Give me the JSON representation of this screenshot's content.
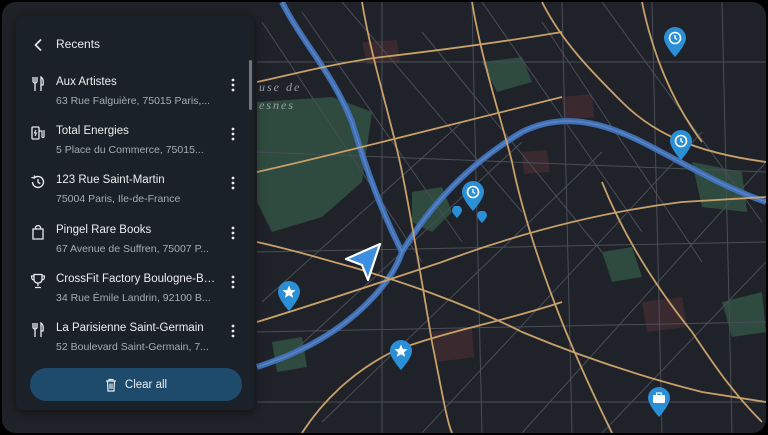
{
  "panel": {
    "title": "Recents",
    "items": [
      {
        "icon": "restaurant-icon",
        "title": "Aux Artistes",
        "subtitle": "63 Rue Falguière, 75015 Paris,..."
      },
      {
        "icon": "ev-station-icon",
        "title": "Total Energies",
        "subtitle": "5 Place du Commerce, 75015..."
      },
      {
        "icon": "history-icon",
        "title": "123 Rue Saint-Martin",
        "subtitle": "75004 Paris, Ile-de-France"
      },
      {
        "icon": "shopping-bag-icon",
        "title": "Pingel Rare Books",
        "subtitle": "67 Avenue de Suffren, 75007 P..."
      },
      {
        "icon": "trophy-icon",
        "title": "CrossFit Factory Boulogne-Bill...",
        "subtitle": "34 Rue Émile Landrin, 92100 B..."
      },
      {
        "icon": "restaurant-icon",
        "title": "La Parisienne Saint-Germain",
        "subtitle": "52 Boulevard Saint-Germain, 7..."
      }
    ],
    "clear_label": "Clear all"
  },
  "map": {
    "labels": [
      "use de",
      "esnes"
    ],
    "markers": [
      "history-icon",
      "history-icon",
      "history-icon",
      "star-icon",
      "star-icon",
      "briefcase-icon"
    ],
    "colors": {
      "background": "#1f2228",
      "road": "#c8a06a",
      "river": "#3f6fb5",
      "park": "#2f4a3e",
      "marker": "#2b8fd6"
    }
  }
}
